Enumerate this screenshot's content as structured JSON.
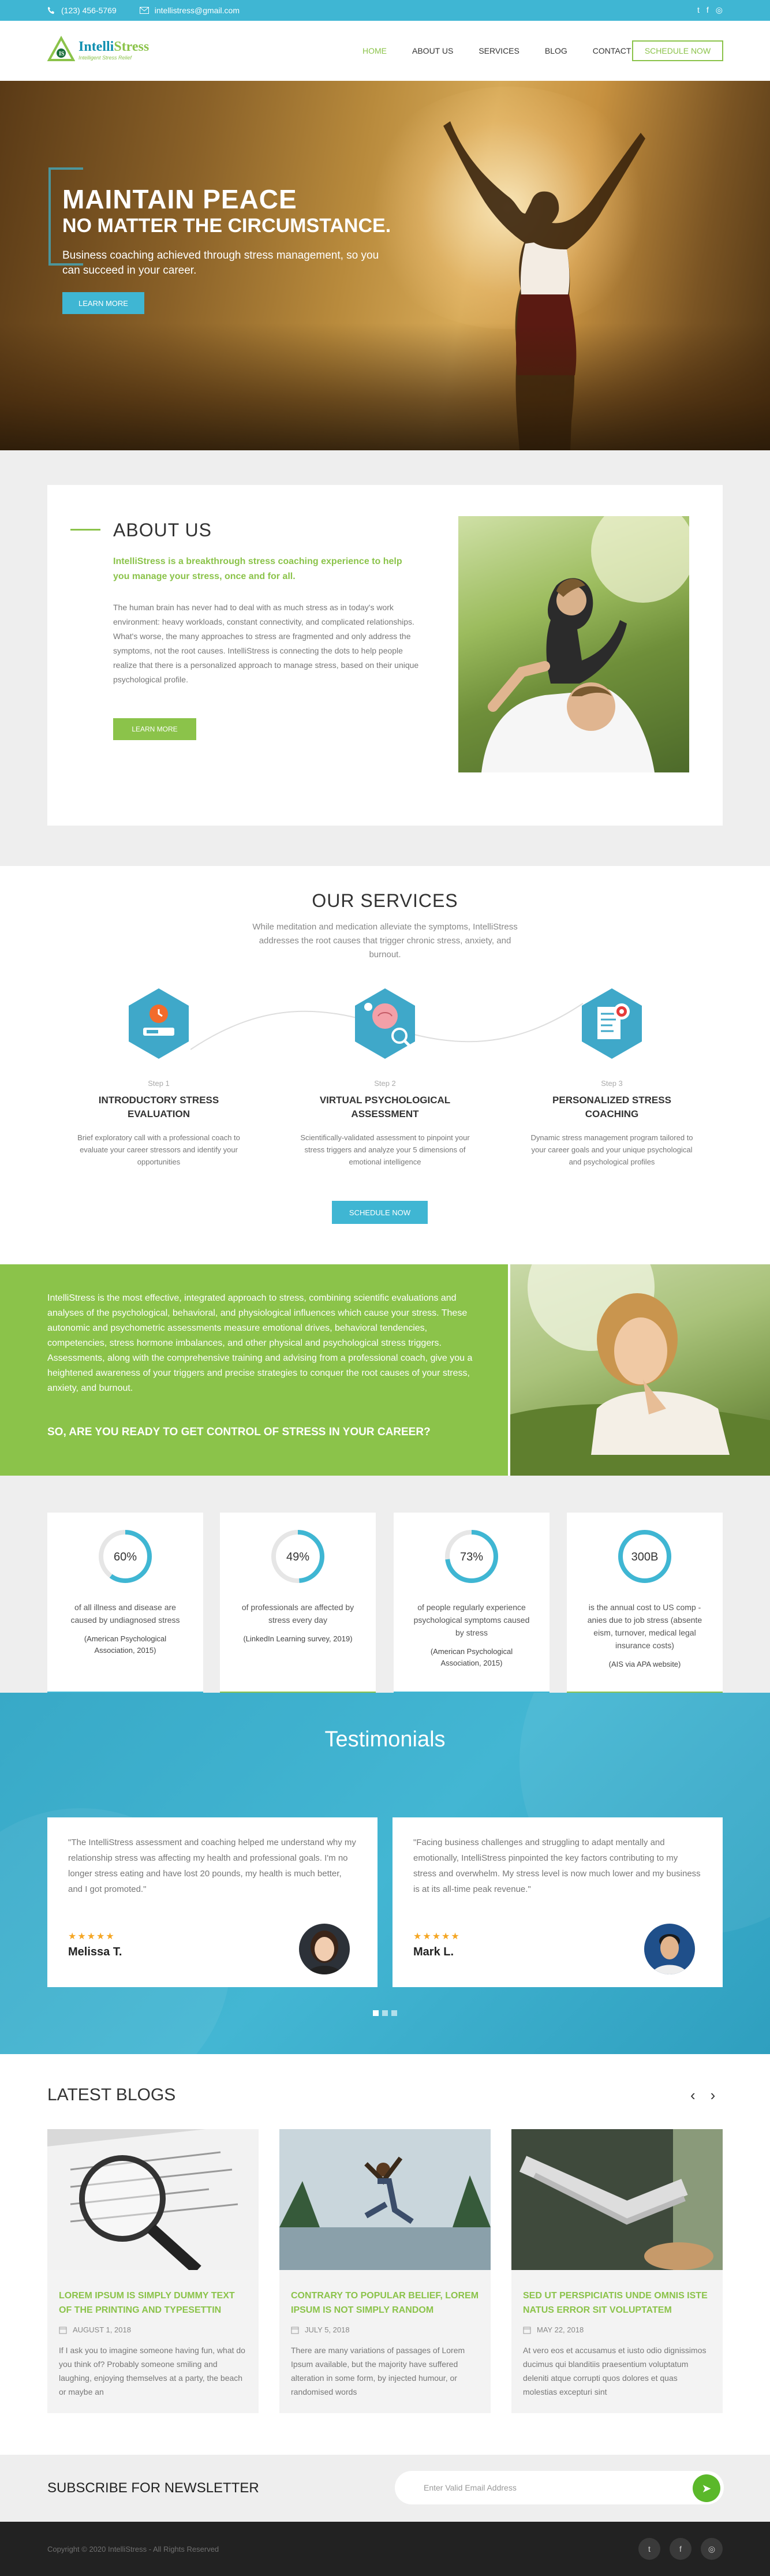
{
  "topbar": {
    "phone": "(123) 456-5769",
    "email": "intellistress@gmail.com",
    "social_twitter": "t",
    "social_facebook": "f",
    "social_instagram": "◎"
  },
  "logo": {
    "name_a": "Intelli",
    "name_b": "Stress",
    "tagline": "Intelligent Stress Relief"
  },
  "nav": [
    "HOME",
    "ABOUT US",
    "SERVICES",
    "BLOG",
    "CONTACT"
  ],
  "header_cta": "SCHEDULE NOW",
  "hero": {
    "title": "MAINTAIN PEACE",
    "subtitle": "NO MATTER THE CIRCUMSTANCE.",
    "text": "Business coaching achieved through stress management, so you can succeed in your career.",
    "button": "LEARN MORE"
  },
  "about": {
    "title": "ABOUT US",
    "lead": "IntelliStress is a breakthrough stress coaching experience to help you manage your stress, once and for all.",
    "body": "The human brain has never had to deal with as much stress as in today's work environment: heavy workloads, constant connectivity, and complicated relationships. What's worse, the many approaches to stress are fragmented and only address the symptoms, not the root causes. IntelliStress is connecting the dots to help people realize that there is a personalized approach to manage stress, based on their unique psychological profile.",
    "button": "LEARN MORE"
  },
  "services": {
    "title": "OUR SERVICES",
    "subtitle": "While meditation and medication alleviate the symptoms, IntelliStress addresses the root causes that trigger chronic stress, anxiety, and burnout.",
    "steps": [
      {
        "num": "Step 1",
        "title": "INTRODUCTORY STRESS EVALUATION",
        "desc": "Brief exploratory call with a professional coach to evaluate your career stressors and identify your opportunities"
      },
      {
        "num": "Step 2",
        "title": "VIRTUAL PSYCHOLOGICAL ASSESSMENT",
        "desc": "Scientifically-validated assessment to pinpoint your stress triggers and analyze your 5 dimensions of emotional intelligence"
      },
      {
        "num": "Step 3",
        "title": "PERSONALIZED STRESS COACHING",
        "desc": "Dynamic stress management program tailored to your career goals and your unique psychological and psychological profiles"
      }
    ],
    "button": "SCHEDULE NOW"
  },
  "promo": {
    "text": "IntelliStress is the most effective, integrated approach to stress, combining scientific evaluations and analyses of the psychological, behavioral, and physiological influences which cause your stress. These autonomic and psychometric assessments measure emotional drives, behavioral tendencies, competencies, stress hormone imbalances, and other physical and psychological stress triggers. Assessments, along with the comprehensive training and advising from a professional coach, give you a heightened awareness of your triggers and precise strategies to conquer the root causes of your stress, anxiety, and burnout.",
    "ask": "SO, ARE YOU READY TO GET CONTROL OF STRESS IN YOUR CAREER?"
  },
  "stats": [
    {
      "value": "60%",
      "fraction": 0.6,
      "label": "of all illness and disease are caused by undiagnosed stress",
      "source": "(American Psychological Association, 2015)"
    },
    {
      "value": "49%",
      "fraction": 0.49,
      "label": "of professionals are affected by stress every day",
      "source": "(LinkedIn Learning survey, 2019)"
    },
    {
      "value": "73%",
      "fraction": 0.73,
      "label": "of people regularly experience psychological symptoms caused by stress",
      "source": "(American Psychological Association, 2015)"
    },
    {
      "value": "300B",
      "fraction": 1,
      "label": "is the annual cost to US comp -anies due to job stress (absente eism, turnover, medical legal insurance costs)",
      "source": "(AIS via APA website)"
    }
  ],
  "testimonials": {
    "title": "Testimonials",
    "items": [
      {
        "quote": "\"The IntelliStress assessment and coaching helped me understand why my relationship stress was affecting my health and professional goals. I'm no longer stress eating and have lost 20 pounds, my health is much better, and I got promoted.\"",
        "stars": "★★★★★",
        "name": "Melissa T."
      },
      {
        "quote": "\"Facing business challenges and struggling to adapt mentally and emotionally, IntelliStress pinpointed the key factors contributing to my stress and overwhelm. My stress level is now much lower  and my business is at its all-time peak revenue.\"",
        "stars": "★★★★★",
        "name": "Mark L."
      }
    ]
  },
  "blogs": {
    "title": "LATEST BLOGS",
    "prev": "‹",
    "next": "›",
    "items": [
      {
        "title": "LOREM IPSUM IS SIMPLY DUMMY TEXT OF THE PRINTING AND TYPESETTIN",
        "date": "AUGUST 1, 2018",
        "excerpt": "If I ask you to imagine someone having fun, what do you think of? Probably someone smiling and laughing, enjoying themselves at a party, the beach or maybe an"
      },
      {
        "title": "CONTRARY TO POPULAR BELIEF, LOREM IPSUM IS NOT SIMPLY RANDOM",
        "date": "JULY 5, 2018",
        "excerpt": "There are many variations of passages of Lorem Ipsum available, but the majority have suffered alteration in some form, by injected humour, or randomised words"
      },
      {
        "title": "SED UT PERSPICIATIS UNDE OMNIS ISTE NATUS ERROR SIT VOLUPTATEM",
        "date": "MAY 22, 2018",
        "excerpt": "At vero eos et accusamus et iusto odio dignissimos ducimus qui blanditiis praesentium voluptatum deleniti atque corrupti quos dolores et quas molestias excepturi sint"
      }
    ]
  },
  "newsletter": {
    "title": "SUBSCRIBE FOR NEWSLETTER",
    "placeholder": "Enter Valid Email Address",
    "submit": "➤"
  },
  "footer": {
    "copyright": "Copyright © 2020 IntelliStress - All Rights Reserved",
    "social": [
      "t",
      "f",
      "◎"
    ]
  },
  "colors": {
    "primary_blue": "#3fb6d3",
    "brand_green": "#8bc34a",
    "dark": "#222222"
  }
}
